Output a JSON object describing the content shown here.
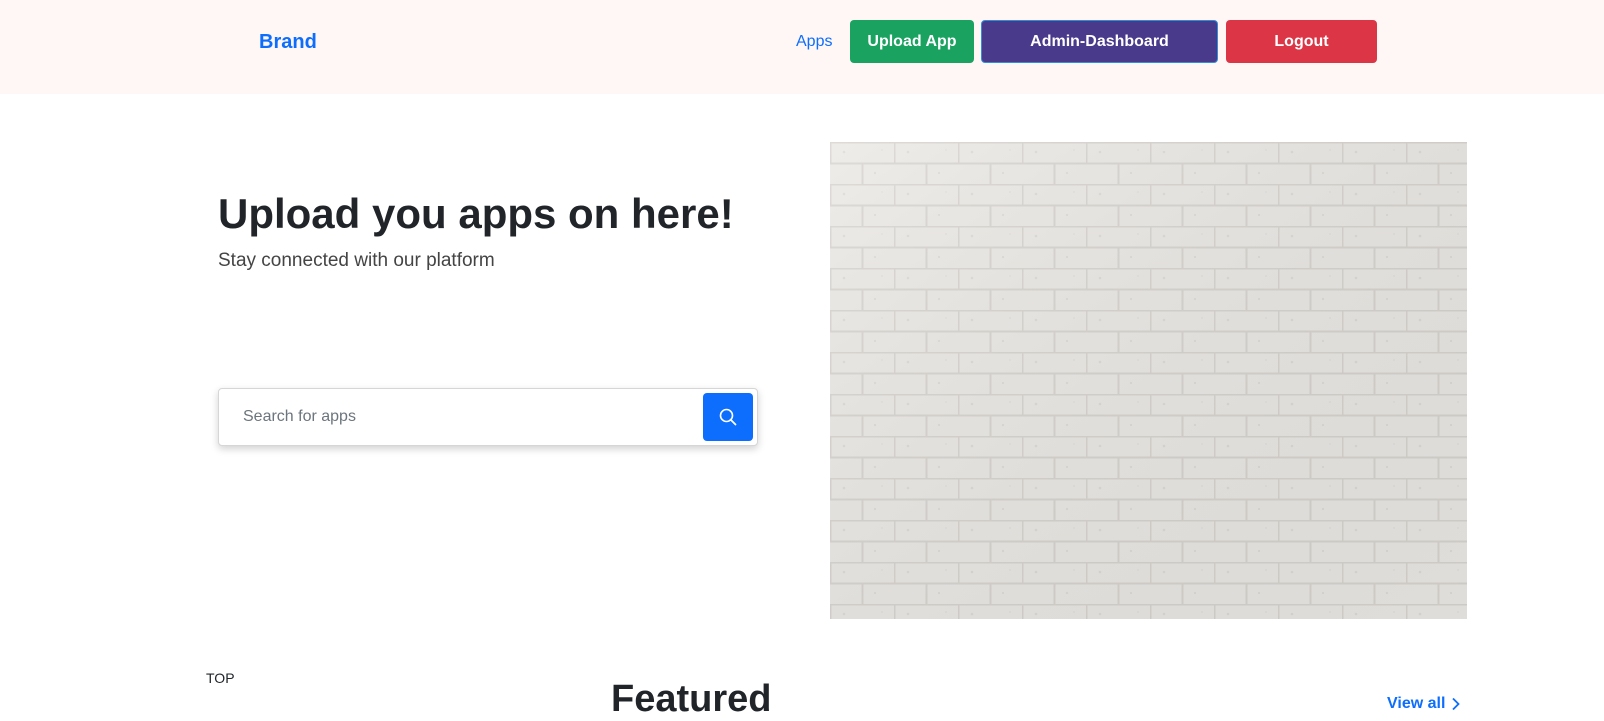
{
  "nav": {
    "brand": "Brand",
    "apps_link": "Apps",
    "upload_label": "Upload App",
    "admin_label": "Admin-Dashboard",
    "logout_label": "Logout"
  },
  "hero": {
    "title": "Upload you apps on here!",
    "subtitle": "Stay connected with our platform",
    "search": {
      "placeholder": "Search for apps",
      "value": ""
    },
    "search_icon": "search-icon",
    "image": "white-brick-wall"
  },
  "section": {
    "top_label": "TOP",
    "featured_title": "Featured",
    "view_all_label": "View all",
    "view_all_icon": "chevron-right-icon"
  },
  "colors": {
    "navbar_bg": "#fff6f6",
    "primary": "#0d6efd",
    "upload": "#1aa260",
    "admin": "#4a3a8c",
    "logout": "#dc3545"
  }
}
